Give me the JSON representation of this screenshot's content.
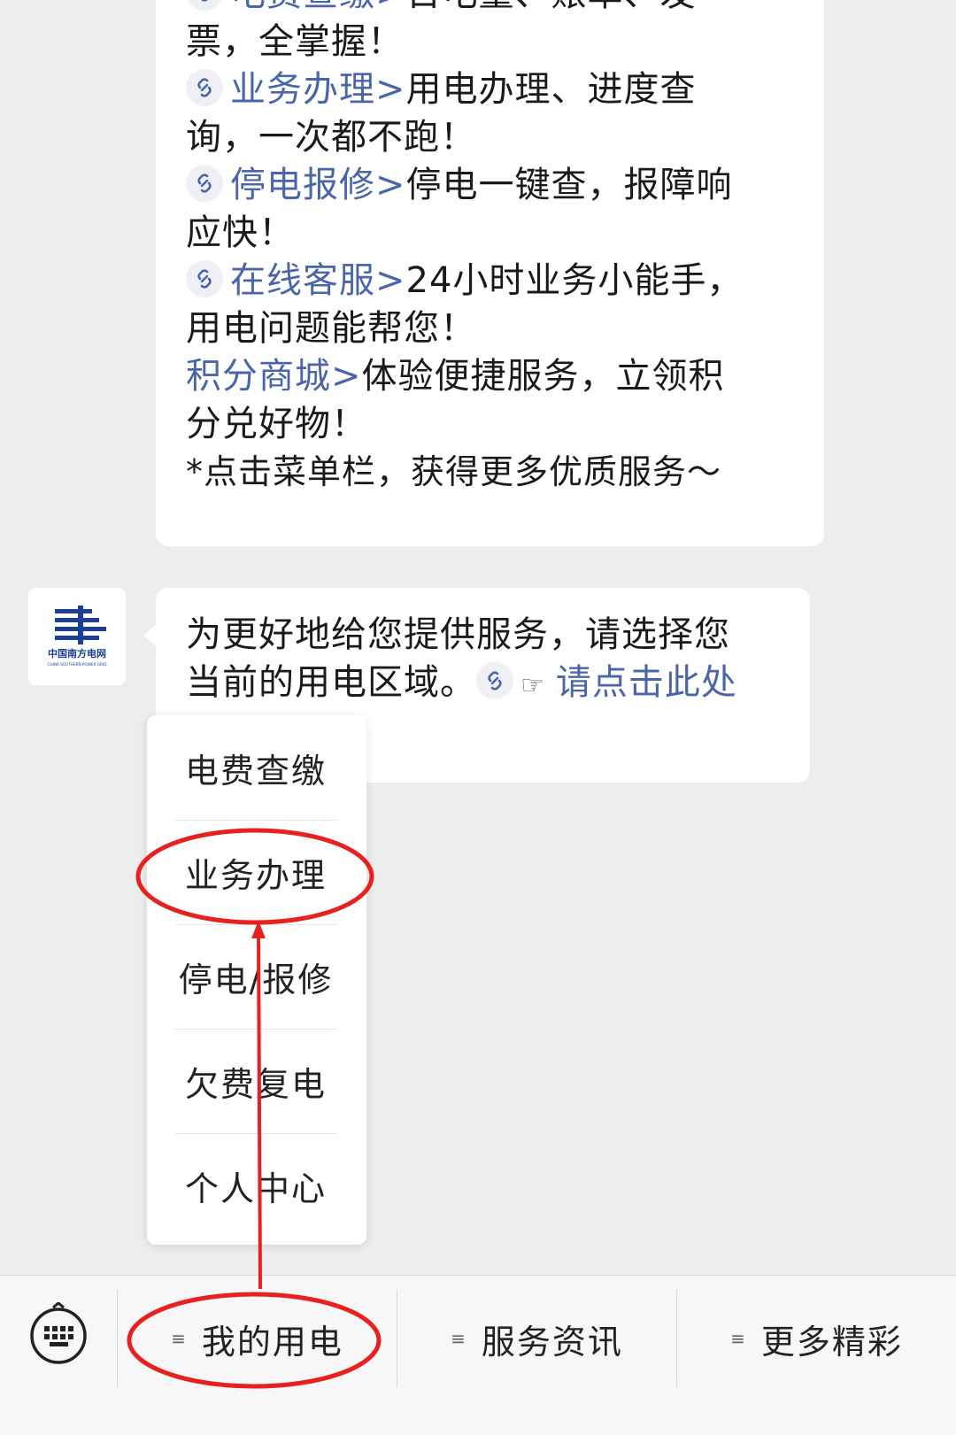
{
  "chat": {
    "bubble1_lines": [
      {
        "link": "电费查缴>",
        "text": "日电量、账单、发",
        "icon": true
      },
      {
        "link": "",
        "text": "票，全掌握！",
        "icon": false
      },
      {
        "link": "业务办理>",
        "text": "用电办理、进度查",
        "icon": true
      },
      {
        "link": "",
        "text": "询，一次都不跑！",
        "icon": false
      },
      {
        "link": "停电报修>",
        "text": "停电一键查，报障响",
        "icon": true
      },
      {
        "link": "",
        "text": "应快！",
        "icon": false
      },
      {
        "link": "在线客服>",
        "text": "24小时业务小能手，",
        "icon": true
      },
      {
        "link": "",
        "text": "用电问题能帮您！",
        "icon": false
      },
      {
        "link": "积分商城>",
        "text": "体验便捷服务，立领积",
        "icon": false
      },
      {
        "link": "",
        "text": "分兑好物！",
        "icon": false
      },
      {
        "link": "",
        "text": "*点击菜单栏，获得更多优质服务～",
        "icon": false
      }
    ],
    "bubble2": {
      "line1": "为更好地给您提供服务，请选择您",
      "line2_text": "当前的用电区域。",
      "line2_link": "请点击此处",
      "hand_icon": "pointing-hand-icon"
    },
    "avatar": {
      "logo_text_cn": "中国南方电网",
      "logo_text_en": "CHINA SOUTHERN POWER GRID"
    }
  },
  "popup_menu": {
    "items": [
      "电费查缴",
      "业务办理",
      "停电/报修",
      "欠费复电",
      "个人中心"
    ]
  },
  "bottom_bar": {
    "keyboard_icon": "keyboard-icon",
    "tabs": [
      "我的用电",
      "服务资讯",
      "更多精彩"
    ],
    "menu_icon": "three-lines-icon"
  },
  "annotation": {
    "color": "#e8211f"
  },
  "colors": {
    "link": "#4a66a8",
    "background": "#ededed"
  }
}
